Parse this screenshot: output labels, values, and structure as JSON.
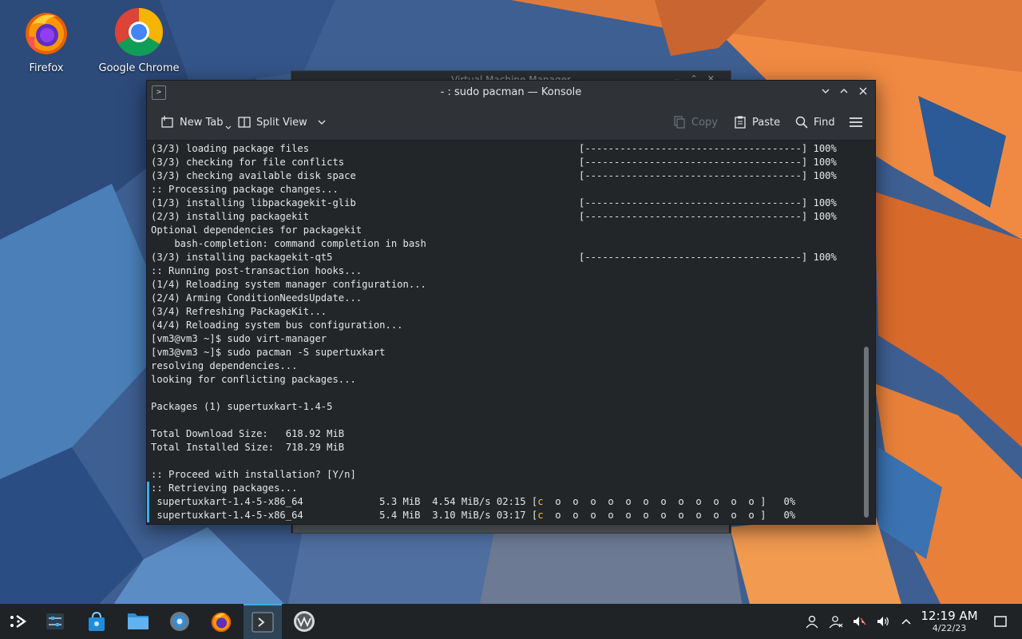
{
  "desktop": {
    "icons": [
      {
        "label": "Firefox"
      },
      {
        "label": "Google Chrome"
      }
    ]
  },
  "background_window": {
    "title": "Virtual Machine Manager"
  },
  "konsole": {
    "title": "- : sudo pacman — Konsole",
    "toolbar": {
      "new_tab": "New Tab",
      "split_view": "Split View",
      "copy": "Copy",
      "paste": "Paste",
      "find": "Find"
    },
    "lines": [
      {
        "text": "(3/3) loading package files",
        "progress": "[-------------------------------------] 100%"
      },
      {
        "text": "(3/3) checking for file conflicts",
        "progress": "[-------------------------------------] 100%"
      },
      {
        "text": "(3/3) checking available disk space",
        "progress": "[-------------------------------------] 100%"
      },
      {
        "text": ":: Processing package changes...",
        "progress": ""
      },
      {
        "text": "(1/3) installing libpackagekit-glib",
        "progress": "[-------------------------------------] 100%"
      },
      {
        "text": "(2/3) installing packagekit",
        "progress": "[-------------------------------------] 100%"
      },
      {
        "text": "Optional dependencies for packagekit",
        "progress": ""
      },
      {
        "text": "    bash-completion: command completion in bash",
        "progress": ""
      },
      {
        "text": "(3/3) installing packagekit-qt5",
        "progress": "[-------------------------------------] 100%"
      },
      {
        "text": ":: Running post-transaction hooks...",
        "progress": ""
      },
      {
        "text": "(1/4) Reloading system manager configuration...",
        "progress": ""
      },
      {
        "text": "(2/4) Arming ConditionNeedsUpdate...",
        "progress": ""
      },
      {
        "text": "(3/4) Refreshing PackageKit...",
        "progress": ""
      },
      {
        "text": "(4/4) Reloading system bus configuration...",
        "progress": ""
      },
      {
        "text": "[vm3@vm3 ~]$ sudo virt-manager",
        "progress": ""
      },
      {
        "text": "[vm3@vm3 ~]$ sudo pacman -S supertuxkart",
        "progress": ""
      },
      {
        "text": "resolving dependencies...",
        "progress": ""
      },
      {
        "text": "looking for conflicting packages...",
        "progress": ""
      },
      {
        "text": "",
        "progress": ""
      },
      {
        "text": "Packages (1) supertuxkart-1.4-5",
        "progress": ""
      },
      {
        "text": "",
        "progress": ""
      },
      {
        "text": "Total Download Size:   618.92 MiB",
        "progress": ""
      },
      {
        "text": "Total Installed Size:  718.29 MiB",
        "progress": ""
      },
      {
        "text": "",
        "progress": ""
      },
      {
        "text": ":: Proceed with installation? [Y/n]",
        "progress": ""
      },
      {
        "text": ":: Retrieving packages...",
        "progress": ""
      }
    ],
    "downloads": [
      {
        "text": " supertuxkart-1.4-5-x86_64             5.3 MiB  4.54 MiB/s 02:15 [",
        "pac": "c",
        "rest": "  o  o  o  o  o  o  o  o  o  o  o  o ]   0%"
      },
      {
        "text": " supertuxkart-1.4-5-x86_64             5.4 MiB  3.10 MiB/s 03:17 [",
        "pac": "c",
        "rest": "  o  o  o  o  o  o  o  o  o  o  o  o ]   0%"
      }
    ]
  },
  "taskbar": {
    "apps": [
      {
        "name": "application-launcher"
      },
      {
        "name": "system-settings-widgets"
      },
      {
        "name": "discover-store"
      },
      {
        "name": "dolphin-files"
      },
      {
        "name": "system-settings"
      },
      {
        "name": "firefox"
      },
      {
        "name": "konsole"
      },
      {
        "name": "virt-manager"
      }
    ],
    "clock": {
      "time": "12:19 AM",
      "date": "4/22/23"
    }
  }
}
